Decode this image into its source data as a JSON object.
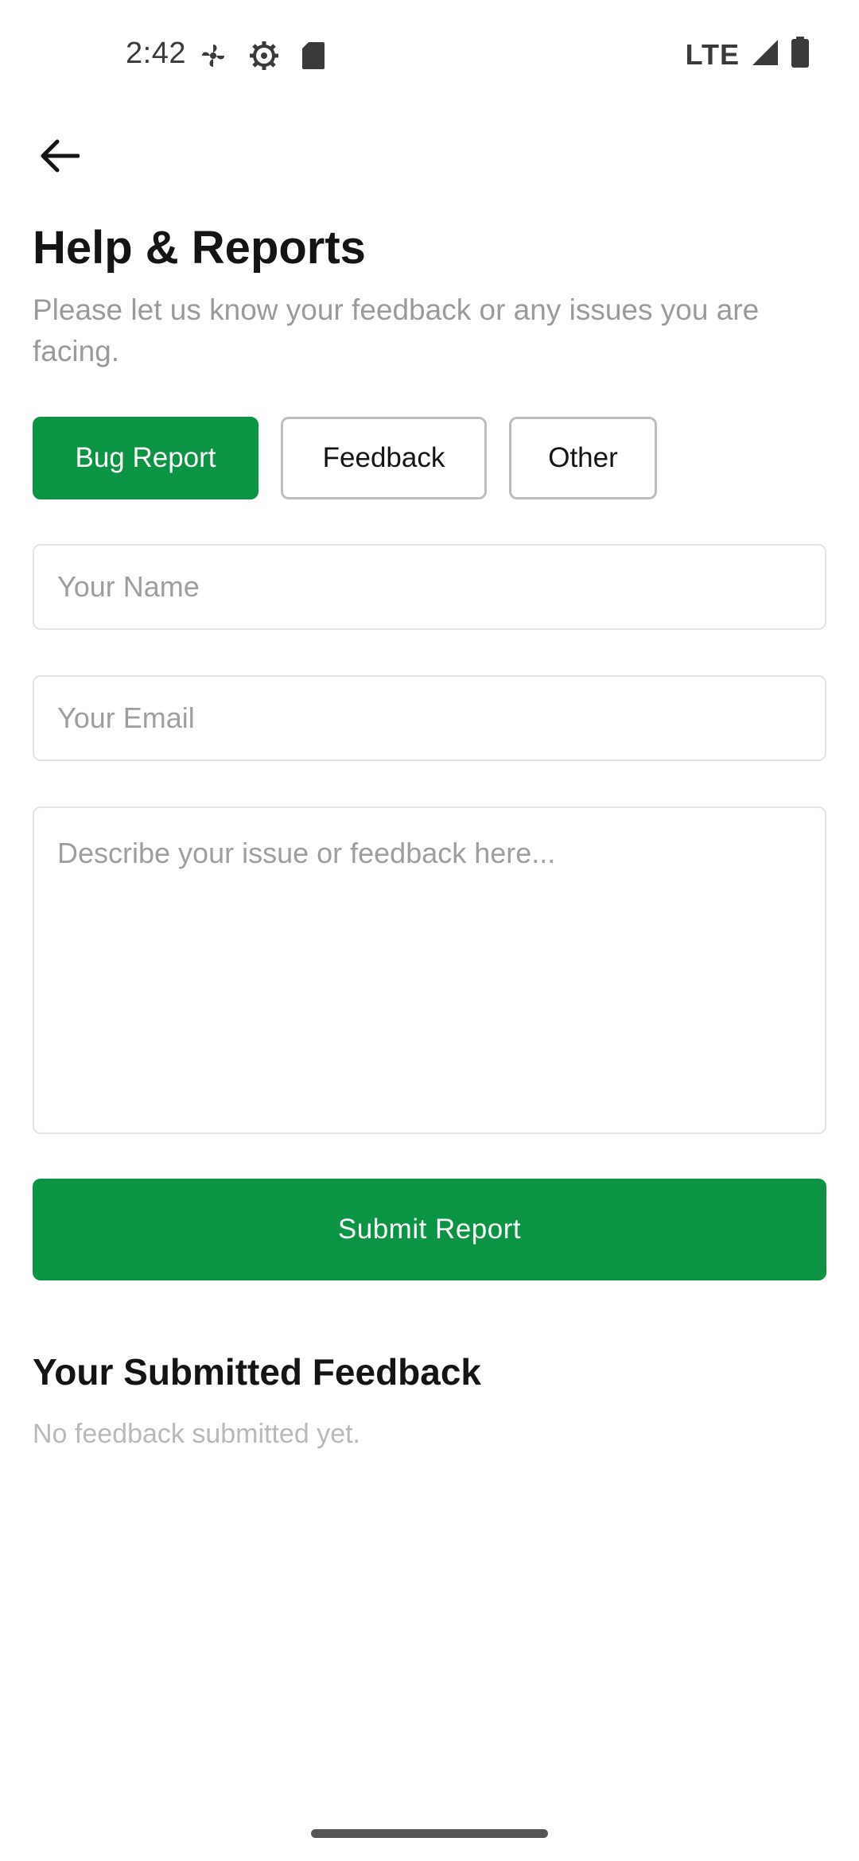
{
  "status_bar": {
    "time": "2:42",
    "network": "LTE",
    "icons": [
      "fan-icon",
      "settings-gear-icon",
      "sd-card-icon",
      "signal-icon",
      "battery-icon"
    ]
  },
  "header": {
    "back_icon": "arrow-left-icon",
    "title": "Help & Reports",
    "subtitle": "Please let us know your feedback or any issues you are facing."
  },
  "categories": {
    "selected": "Bug Report",
    "items": [
      {
        "label": "Bug Report"
      },
      {
        "label": "Feedback"
      },
      {
        "label": "Other"
      }
    ]
  },
  "form": {
    "name": {
      "value": "",
      "placeholder": "Your Name"
    },
    "email": {
      "value": "",
      "placeholder": "Your Email"
    },
    "description": {
      "value": "",
      "placeholder": "Describe your issue or feedback here..."
    },
    "submit_label": "Submit Report"
  },
  "submitted": {
    "title": "Your Submitted Feedback",
    "empty_message": "No feedback submitted yet."
  },
  "colors": {
    "accent": "#0a9444",
    "text_primary": "#141414",
    "text_muted": "#9a9a9a",
    "border": "#e3e3e3"
  }
}
